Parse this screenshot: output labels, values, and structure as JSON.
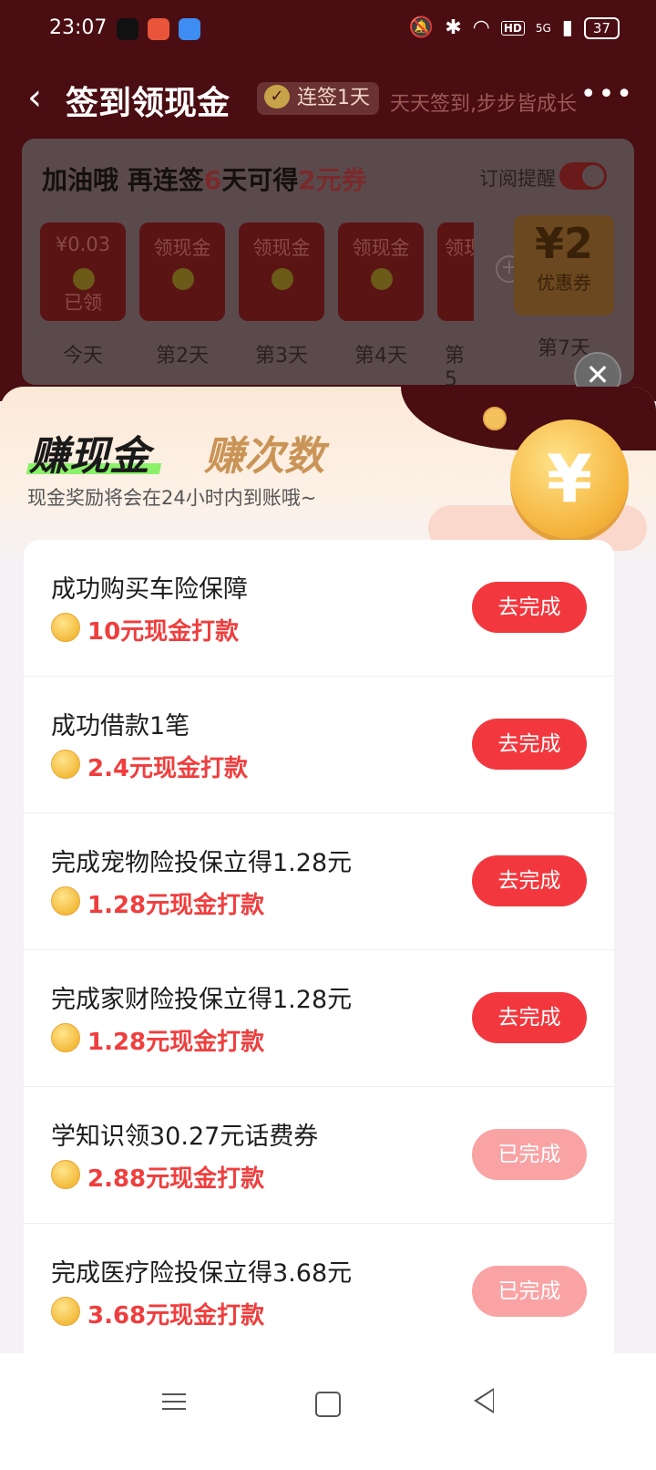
{
  "status": {
    "time": "23:07",
    "hd": "HD",
    "signal": "5G",
    "battery": "37"
  },
  "nav": {
    "title": "签到领现金",
    "streak": "连签1天",
    "slogan": "天天签到,步步皆成长"
  },
  "checkin": {
    "headline_prefix": "加油哦 再连签",
    "days_left": "6",
    "headline_mid": "天可得",
    "reward": "2元券",
    "subscribe_label": "订阅提醒",
    "days": [
      {
        "top": "¥0.03",
        "bottom": "已领",
        "label": "今天"
      },
      {
        "top": "领现金",
        "bottom": "",
        "label": "第2天"
      },
      {
        "top": "领现金",
        "bottom": "",
        "label": "第3天"
      },
      {
        "top": "领现金",
        "bottom": "",
        "label": "第4天"
      },
      {
        "top": "领现",
        "bottom": "",
        "label": "第5"
      }
    ],
    "coupon": {
      "amount": "¥2",
      "label": "优惠券",
      "day": "第7天"
    }
  },
  "sheet": {
    "tab_active": "赚现金",
    "tab_inactive": "赚次数",
    "subtitle": "现金奖励将会在24小时内到账哦~",
    "coin_symbol": "¥"
  },
  "tasks": [
    {
      "title": "成功购买车险保障",
      "reward": "10元现金打款",
      "button": "去完成",
      "done": false
    },
    {
      "title": "成功借款1笔",
      "reward": "2.4元现金打款",
      "button": "去完成",
      "done": false
    },
    {
      "title": "完成宠物险投保立得1.28元",
      "reward": "1.28元现金打款",
      "button": "去完成",
      "done": false
    },
    {
      "title": "完成家财险投保立得1.28元",
      "reward": "1.28元现金打款",
      "button": "去完成",
      "done": false
    },
    {
      "title": "学知识领30.27元话费券",
      "reward": "2.88元现金打款",
      "button": "已完成",
      "done": true
    },
    {
      "title": "完成医疗险投保立得3.68元",
      "reward": "3.68元现金打款",
      "button": "已完成",
      "done": true
    }
  ],
  "colors": {
    "primary_red": "#f2383e",
    "done_red": "#f9a3a5",
    "reward_red": "#ef3e3e",
    "accent_green": "#8bf06a"
  }
}
